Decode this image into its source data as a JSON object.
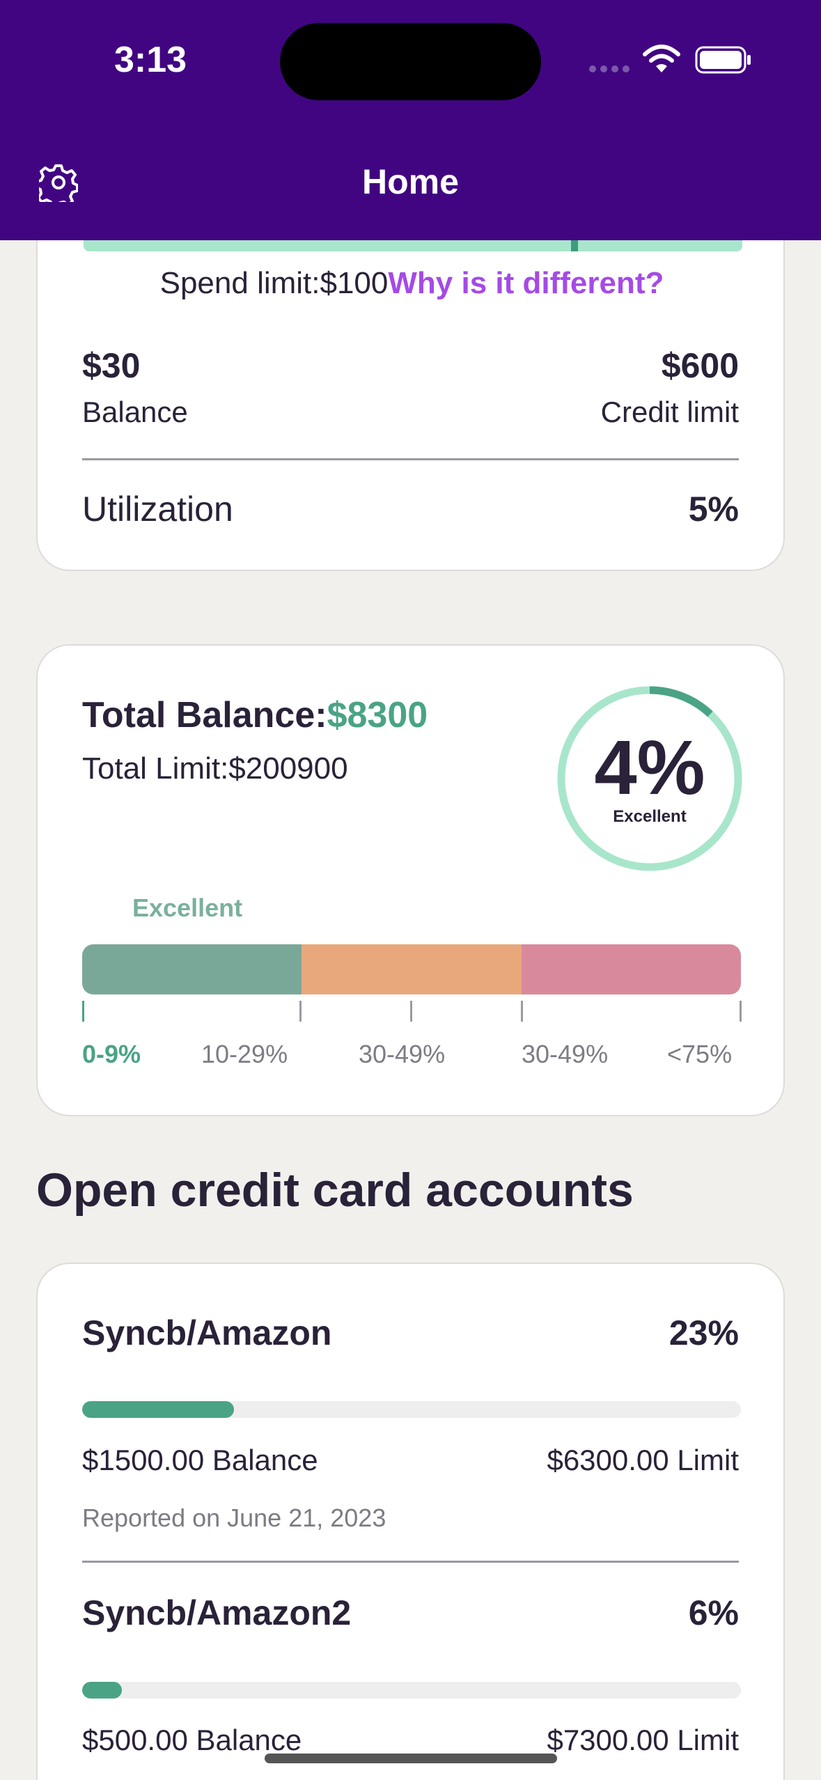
{
  "status_bar": {
    "time": "3:13"
  },
  "header": {
    "title": "Home",
    "settings_icon": "gear-icon"
  },
  "spend_card": {
    "spend_limit_text": "Spend limit:$100",
    "why_link": "Why is it different?",
    "balance_value": "$30",
    "balance_label": "Balance",
    "credit_limit_value": "$600",
    "credit_limit_label": "Credit limit",
    "utilization_label": "Utilization",
    "utilization_value": "5%"
  },
  "total_card": {
    "total_balance_label": "Total Balance:",
    "total_balance_value": "$8300",
    "total_limit_text": "Total Limit:$200900",
    "gauge_value": "4%",
    "gauge_fraction": 0.12,
    "gauge_label": "Excellent",
    "range_caption": "Excellent",
    "range_labels": [
      "0-9%",
      "10-29%",
      "30-49%",
      "30-49%",
      "<75%"
    ],
    "colors": {
      "excellent": "#7aa898",
      "fair": "#e8a87c",
      "poor": "#d88a9b",
      "accent": "#4aa385",
      "gauge_track": "#a8e6cc"
    }
  },
  "section": {
    "title": "Open credit card accounts"
  },
  "accounts": [
    {
      "name": "Syncb/Amazon",
      "pct": "23%",
      "fill": 0.23,
      "balance": "$1500.00 Balance",
      "limit": "$6300.00 Limit",
      "reported": "Reported on June 21, 2023"
    },
    {
      "name": "Syncb/Amazon2",
      "pct": "6%",
      "fill": 0.06,
      "balance": "$500.00 Balance",
      "limit": "$7300.00 Limit"
    }
  ]
}
